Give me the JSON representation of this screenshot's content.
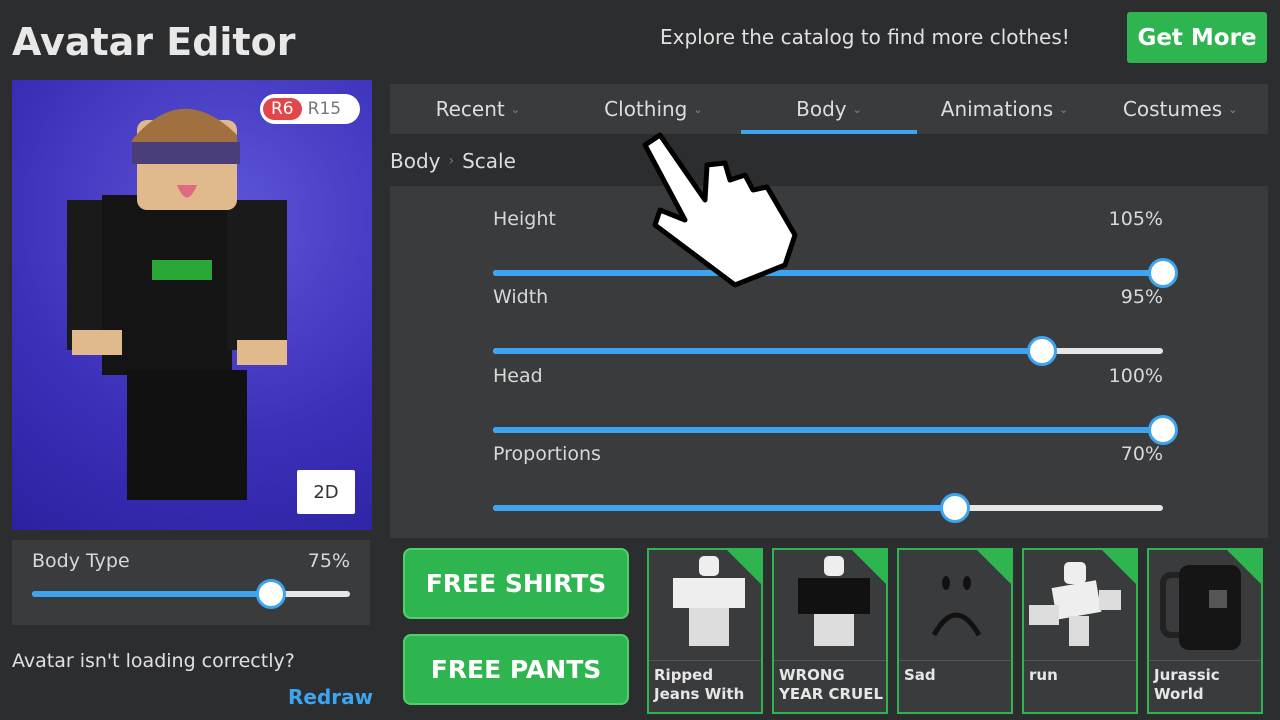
{
  "header": {
    "title": "Avatar Editor",
    "explore_text": "Explore the catalog to find more clothes!",
    "get_more_label": "Get More"
  },
  "avatar": {
    "rig_options": [
      "R6",
      "R15"
    ],
    "selected_rig": "R6",
    "view_toggle": "2D"
  },
  "body_type": {
    "label": "Body Type",
    "value": "75%",
    "fraction": 0.75
  },
  "loading": {
    "text": "Avatar isn't loading correctly?",
    "redraw_label": "Redraw"
  },
  "tabs": [
    {
      "label": "Recent"
    },
    {
      "label": "Clothing"
    },
    {
      "label": "Body",
      "active": true
    },
    {
      "label": "Animations"
    },
    {
      "label": "Costumes"
    }
  ],
  "breadcrumb": [
    "Body",
    "Scale"
  ],
  "sliders": [
    {
      "label": "Height",
      "value": "105%",
      "fraction": 1.0
    },
    {
      "label": "Width",
      "value": "95%",
      "fraction": 0.82
    },
    {
      "label": "Head",
      "value": "100%",
      "fraction": 1.0
    },
    {
      "label": "Proportions",
      "value": "70%",
      "fraction": 0.69
    }
  ],
  "promo": {
    "shirts_label": "FREE SHIRTS",
    "pants_label": "FREE PANTS"
  },
  "items": [
    {
      "name": "Ripped Jeans With"
    },
    {
      "name": "WRONG YEAR CRUEL"
    },
    {
      "name": "Sad"
    },
    {
      "name": "run"
    },
    {
      "name": "Jurassic World"
    }
  ],
  "colors": {
    "accent": "#3da4f0",
    "green": "#2fb54f",
    "rig_active": "#e2454a",
    "panel": "#393b3d",
    "background": "#2c2d2f"
  }
}
